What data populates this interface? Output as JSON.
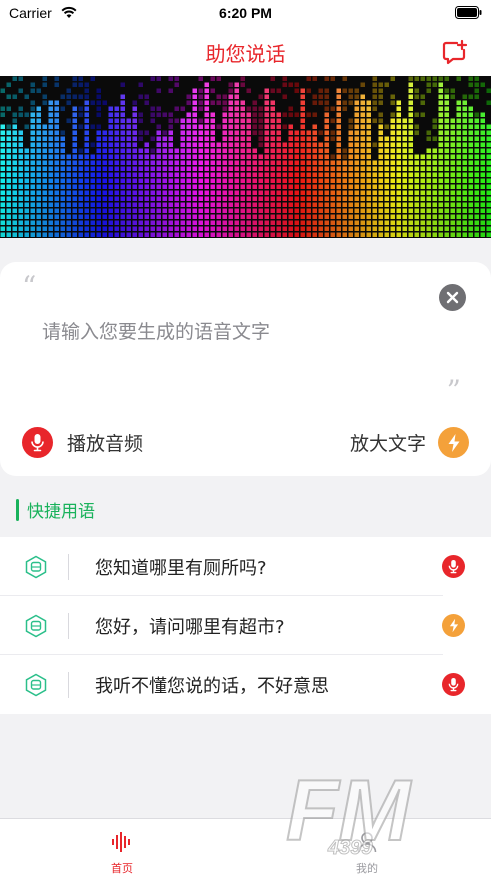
{
  "status_bar": {
    "carrier": "Carrier",
    "time": "6:20 PM"
  },
  "nav": {
    "title": "助您说话",
    "add_icon": "chat-add-icon"
  },
  "input_card": {
    "placeholder": "请输入您要生成的语音文字",
    "value": "",
    "open_quote": "“",
    "close_quote": "”",
    "play_label": "播放音频",
    "enlarge_label": "放大文字"
  },
  "quick_phrases": {
    "title": "快捷用语",
    "items": [
      {
        "text": "您知道哪里有厕所吗?",
        "action": "mic-icon",
        "color": "#e8262b"
      },
      {
        "text": "您好，请问哪里有超市?",
        "action": "bolt-icon",
        "color": "#f4a13a"
      },
      {
        "text": "我听不懂您说的话，不好意思",
        "action": "mic-icon",
        "color": "#e8262b"
      }
    ]
  },
  "tab_bar": {
    "tabs": [
      {
        "label": "首页",
        "icon": "waveform-icon",
        "active": true
      },
      {
        "label": "我的",
        "icon": "person-icon",
        "active": false
      }
    ]
  },
  "colors": {
    "accent": "#e8262b",
    "green": "#19b25b",
    "orange": "#f4a13a"
  },
  "watermark": {
    "text": "FM",
    "sub": "4399"
  }
}
